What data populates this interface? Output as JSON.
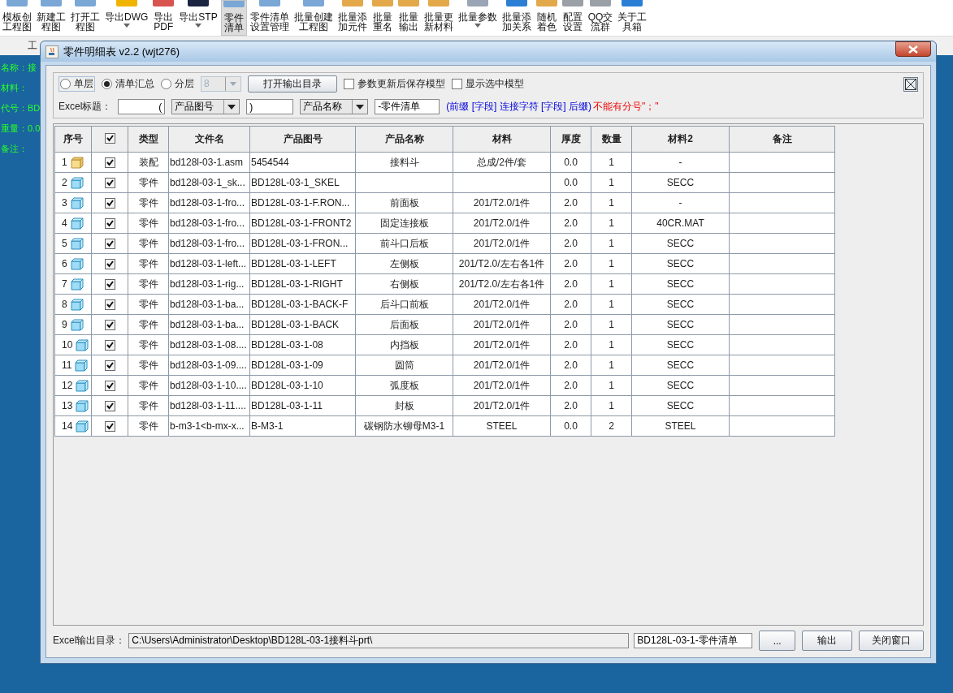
{
  "toolbar": {
    "items": [
      {
        "lines": [
          "模板创",
          "工程图"
        ],
        "caret": false,
        "selected": false
      },
      {
        "lines": [
          "新建工",
          "程图"
        ],
        "caret": false,
        "selected": false
      },
      {
        "lines": [
          "打开工",
          "程图"
        ],
        "caret": false,
        "selected": false
      },
      {
        "lines": [
          "导出DWG"
        ],
        "caret": true,
        "selected": false
      },
      {
        "lines": [
          "导出",
          "PDF"
        ],
        "caret": false,
        "selected": false
      },
      {
        "lines": [
          "导出STP"
        ],
        "caret": true,
        "selected": false
      },
      {
        "lines": [
          "零件",
          "清单"
        ],
        "caret": false,
        "selected": true
      },
      {
        "lines": [
          "零件清单",
          "设置管理"
        ],
        "caret": false,
        "selected": false
      },
      {
        "lines": [
          "批量创建",
          "工程图"
        ],
        "caret": false,
        "selected": false
      },
      {
        "lines": [
          "批量添",
          "加元件"
        ],
        "caret": false,
        "selected": false
      },
      {
        "lines": [
          "批量",
          "重名"
        ],
        "caret": false,
        "selected": false
      },
      {
        "lines": [
          "批量",
          "输出"
        ],
        "caret": false,
        "selected": false
      },
      {
        "lines": [
          "批量更",
          "新材料"
        ],
        "caret": false,
        "selected": false
      },
      {
        "lines": [
          "批量参数"
        ],
        "caret": true,
        "selected": false
      },
      {
        "lines": [
          "批量添",
          "加关系"
        ],
        "caret": false,
        "selected": false
      },
      {
        "lines": [
          "随机",
          "着色"
        ],
        "caret": false,
        "selected": false
      },
      {
        "lines": [
          "配置",
          "设置"
        ],
        "caret": false,
        "selected": false
      },
      {
        "lines": [
          "QQ交",
          "流群"
        ],
        "caret": false,
        "selected": false
      },
      {
        "lines": [
          "关于工",
          "具箱"
        ],
        "caret": false,
        "selected": false
      }
    ]
  },
  "group_label": "工",
  "side_fields": [
    "名称：接",
    "材料：",
    "代号：BD",
    "重量：0.0",
    "备注："
  ],
  "dialog": {
    "title": "零件明细表 v2.2 (wjt276)",
    "modes": [
      {
        "label": "单层",
        "selected": false
      },
      {
        "label": "清单汇总",
        "selected": true
      },
      {
        "label": "分层",
        "selected": false
      }
    ],
    "level_combo": {
      "value": "8",
      "disabled": true
    },
    "open_dir_button": "打开输出目录",
    "options": [
      {
        "label": "参数更新后保存模型",
        "checked": false
      },
      {
        "label": "显示选中模型",
        "checked": false
      }
    ],
    "title_label": "Excel标题：",
    "title_parts": [
      {
        "kind": "field",
        "value": "("
      },
      {
        "kind": "combo",
        "value": "产品图号"
      },
      {
        "kind": "field",
        "value": ")"
      },
      {
        "kind": "combo",
        "value": "产品名称"
      },
      {
        "kind": "field",
        "value": "-零件清单"
      }
    ],
    "hint": "(前缀 [字段] 连接字符 [字段] 后缀)",
    "warning": "不能有分号\"；\"",
    "table": {
      "columns": [
        "序号",
        "",
        "类型",
        "文件名",
        "产品图号",
        "产品名称",
        "材料",
        "厚度",
        "数量",
        "材料2",
        "备注"
      ],
      "header_checked": true,
      "rows": [
        {
          "kind": "assembly",
          "checked": true,
          "cells": [
            "1",
            "",
            "装配",
            "bd128l-03-1.asm",
            "5454544",
            "接料斗",
            "总成/2件/套",
            "0.0",
            "1",
            "-",
            ""
          ]
        },
        {
          "kind": "part",
          "checked": true,
          "cells": [
            "2",
            "",
            "零件",
            "bd128l-03-1_sk...",
            "BD128L-03-1_SKEL",
            "",
            "",
            "0.0",
            "1",
            "SECC",
            ""
          ]
        },
        {
          "kind": "part",
          "checked": true,
          "cells": [
            "3",
            "",
            "零件",
            "bd128l-03-1-fro...",
            "BD128L-03-1-F.RON...",
            "前面板",
            "201/T2.0/1件",
            "2.0",
            "1",
            "-",
            ""
          ]
        },
        {
          "kind": "part",
          "checked": true,
          "cells": [
            "4",
            "",
            "零件",
            "bd128l-03-1-fro...",
            "BD128L-03-1-FRONT2",
            "固定连接板",
            "201/T2.0/1件",
            "2.0",
            "1",
            "40CR.MAT",
            ""
          ]
        },
        {
          "kind": "part",
          "checked": true,
          "cells": [
            "5",
            "",
            "零件",
            "bd128l-03-1-fro...",
            "BD128L-03-1-FRON...",
            "前斗口后板",
            "201/T2.0/1件",
            "2.0",
            "1",
            "SECC",
            ""
          ]
        },
        {
          "kind": "part",
          "checked": true,
          "cells": [
            "6",
            "",
            "零件",
            "bd128l-03-1-left...",
            "BD128L-03-1-LEFT",
            "左侧板",
            "201/T2.0/左右各1件",
            "2.0",
            "1",
            "SECC",
            ""
          ]
        },
        {
          "kind": "part",
          "checked": true,
          "cells": [
            "7",
            "",
            "零件",
            "bd128l-03-1-rig...",
            "BD128L-03-1-RIGHT",
            "右侧板",
            "201/T2.0/左右各1件",
            "2.0",
            "1",
            "SECC",
            ""
          ]
        },
        {
          "kind": "part",
          "checked": true,
          "cells": [
            "8",
            "",
            "零件",
            "bd128l-03-1-ba...",
            "BD128L-03-1-BACK-F",
            "后斗口前板",
            "201/T2.0/1件",
            "2.0",
            "1",
            "SECC",
            ""
          ]
        },
        {
          "kind": "part",
          "checked": true,
          "cells": [
            "9",
            "",
            "零件",
            "bd128l-03-1-ba...",
            "BD128L-03-1-BACK",
            "后面板",
            "201/T2.0/1件",
            "2.0",
            "1",
            "SECC",
            ""
          ]
        },
        {
          "kind": "part",
          "checked": true,
          "cells": [
            "10",
            "",
            "零件",
            "bd128l-03-1-08....",
            "BD128L-03-1-08",
            "内挡板",
            "201/T2.0/1件",
            "2.0",
            "1",
            "SECC",
            ""
          ]
        },
        {
          "kind": "part",
          "checked": true,
          "cells": [
            "11",
            "",
            "零件",
            "bd128l-03-1-09....",
            "BD128L-03-1-09",
            "圆筒",
            "201/T2.0/1件",
            "2.0",
            "1",
            "SECC",
            ""
          ]
        },
        {
          "kind": "part",
          "checked": true,
          "cells": [
            "12",
            "",
            "零件",
            "bd128l-03-1-10....",
            "BD128L-03-1-10",
            "弧度板",
            "201/T2.0/1件",
            "2.0",
            "1",
            "SECC",
            ""
          ]
        },
        {
          "kind": "part",
          "checked": true,
          "cells": [
            "13",
            "",
            "零件",
            "bd128l-03-1-11....",
            "BD128L-03-1-11",
            "封板",
            "201/T2.0/1件",
            "2.0",
            "1",
            "SECC",
            ""
          ]
        },
        {
          "kind": "part",
          "checked": true,
          "cells": [
            "14",
            "",
            "零件",
            "b-m3-1<b-mx-x...",
            "B-M3-1",
            "碳钢防水铆母M3-1",
            "STEEL",
            "0.0",
            "2",
            "STEEL",
            ""
          ]
        }
      ]
    },
    "output_label": "Excel输出目录：",
    "output_path": "C:\\Users\\Administrator\\Desktop\\BD128L-03-1接料斗prt\\",
    "output_name": "BD128L-03-1-零件清单",
    "buttons": [
      "...",
      "输出",
      "关闭窗口"
    ]
  }
}
